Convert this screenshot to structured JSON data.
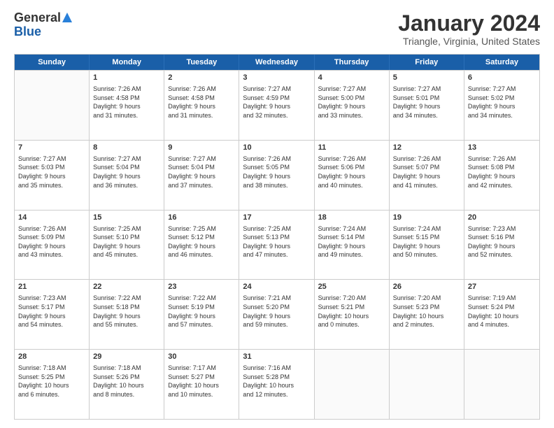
{
  "logo": {
    "general": "General",
    "blue": "Blue"
  },
  "title": {
    "month": "January 2024",
    "location": "Triangle, Virginia, United States"
  },
  "calendar": {
    "headers": [
      "Sunday",
      "Monday",
      "Tuesday",
      "Wednesday",
      "Thursday",
      "Friday",
      "Saturday"
    ],
    "rows": [
      [
        {
          "day": "",
          "lines": []
        },
        {
          "day": "1",
          "lines": [
            "Sunrise: 7:26 AM",
            "Sunset: 4:58 PM",
            "Daylight: 9 hours",
            "and 31 minutes."
          ]
        },
        {
          "day": "2",
          "lines": [
            "Sunrise: 7:26 AM",
            "Sunset: 4:58 PM",
            "Daylight: 9 hours",
            "and 31 minutes."
          ]
        },
        {
          "day": "3",
          "lines": [
            "Sunrise: 7:27 AM",
            "Sunset: 4:59 PM",
            "Daylight: 9 hours",
            "and 32 minutes."
          ]
        },
        {
          "day": "4",
          "lines": [
            "Sunrise: 7:27 AM",
            "Sunset: 5:00 PM",
            "Daylight: 9 hours",
            "and 33 minutes."
          ]
        },
        {
          "day": "5",
          "lines": [
            "Sunrise: 7:27 AM",
            "Sunset: 5:01 PM",
            "Daylight: 9 hours",
            "and 34 minutes."
          ]
        },
        {
          "day": "6",
          "lines": [
            "Sunrise: 7:27 AM",
            "Sunset: 5:02 PM",
            "Daylight: 9 hours",
            "and 34 minutes."
          ]
        }
      ],
      [
        {
          "day": "7",
          "lines": [
            "Sunrise: 7:27 AM",
            "Sunset: 5:03 PM",
            "Daylight: 9 hours",
            "and 35 minutes."
          ]
        },
        {
          "day": "8",
          "lines": [
            "Sunrise: 7:27 AM",
            "Sunset: 5:04 PM",
            "Daylight: 9 hours",
            "and 36 minutes."
          ]
        },
        {
          "day": "9",
          "lines": [
            "Sunrise: 7:27 AM",
            "Sunset: 5:04 PM",
            "Daylight: 9 hours",
            "and 37 minutes."
          ]
        },
        {
          "day": "10",
          "lines": [
            "Sunrise: 7:26 AM",
            "Sunset: 5:05 PM",
            "Daylight: 9 hours",
            "and 38 minutes."
          ]
        },
        {
          "day": "11",
          "lines": [
            "Sunrise: 7:26 AM",
            "Sunset: 5:06 PM",
            "Daylight: 9 hours",
            "and 40 minutes."
          ]
        },
        {
          "day": "12",
          "lines": [
            "Sunrise: 7:26 AM",
            "Sunset: 5:07 PM",
            "Daylight: 9 hours",
            "and 41 minutes."
          ]
        },
        {
          "day": "13",
          "lines": [
            "Sunrise: 7:26 AM",
            "Sunset: 5:08 PM",
            "Daylight: 9 hours",
            "and 42 minutes."
          ]
        }
      ],
      [
        {
          "day": "14",
          "lines": [
            "Sunrise: 7:26 AM",
            "Sunset: 5:09 PM",
            "Daylight: 9 hours",
            "and 43 minutes."
          ]
        },
        {
          "day": "15",
          "lines": [
            "Sunrise: 7:25 AM",
            "Sunset: 5:10 PM",
            "Daylight: 9 hours",
            "and 45 minutes."
          ]
        },
        {
          "day": "16",
          "lines": [
            "Sunrise: 7:25 AM",
            "Sunset: 5:12 PM",
            "Daylight: 9 hours",
            "and 46 minutes."
          ]
        },
        {
          "day": "17",
          "lines": [
            "Sunrise: 7:25 AM",
            "Sunset: 5:13 PM",
            "Daylight: 9 hours",
            "and 47 minutes."
          ]
        },
        {
          "day": "18",
          "lines": [
            "Sunrise: 7:24 AM",
            "Sunset: 5:14 PM",
            "Daylight: 9 hours",
            "and 49 minutes."
          ]
        },
        {
          "day": "19",
          "lines": [
            "Sunrise: 7:24 AM",
            "Sunset: 5:15 PM",
            "Daylight: 9 hours",
            "and 50 minutes."
          ]
        },
        {
          "day": "20",
          "lines": [
            "Sunrise: 7:23 AM",
            "Sunset: 5:16 PM",
            "Daylight: 9 hours",
            "and 52 minutes."
          ]
        }
      ],
      [
        {
          "day": "21",
          "lines": [
            "Sunrise: 7:23 AM",
            "Sunset: 5:17 PM",
            "Daylight: 9 hours",
            "and 54 minutes."
          ]
        },
        {
          "day": "22",
          "lines": [
            "Sunrise: 7:22 AM",
            "Sunset: 5:18 PM",
            "Daylight: 9 hours",
            "and 55 minutes."
          ]
        },
        {
          "day": "23",
          "lines": [
            "Sunrise: 7:22 AM",
            "Sunset: 5:19 PM",
            "Daylight: 9 hours",
            "and 57 minutes."
          ]
        },
        {
          "day": "24",
          "lines": [
            "Sunrise: 7:21 AM",
            "Sunset: 5:20 PM",
            "Daylight: 9 hours",
            "and 59 minutes."
          ]
        },
        {
          "day": "25",
          "lines": [
            "Sunrise: 7:20 AM",
            "Sunset: 5:21 PM",
            "Daylight: 10 hours",
            "and 0 minutes."
          ]
        },
        {
          "day": "26",
          "lines": [
            "Sunrise: 7:20 AM",
            "Sunset: 5:23 PM",
            "Daylight: 10 hours",
            "and 2 minutes."
          ]
        },
        {
          "day": "27",
          "lines": [
            "Sunrise: 7:19 AM",
            "Sunset: 5:24 PM",
            "Daylight: 10 hours",
            "and 4 minutes."
          ]
        }
      ],
      [
        {
          "day": "28",
          "lines": [
            "Sunrise: 7:18 AM",
            "Sunset: 5:25 PM",
            "Daylight: 10 hours",
            "and 6 minutes."
          ]
        },
        {
          "day": "29",
          "lines": [
            "Sunrise: 7:18 AM",
            "Sunset: 5:26 PM",
            "Daylight: 10 hours",
            "and 8 minutes."
          ]
        },
        {
          "day": "30",
          "lines": [
            "Sunrise: 7:17 AM",
            "Sunset: 5:27 PM",
            "Daylight: 10 hours",
            "and 10 minutes."
          ]
        },
        {
          "day": "31",
          "lines": [
            "Sunrise: 7:16 AM",
            "Sunset: 5:28 PM",
            "Daylight: 10 hours",
            "and 12 minutes."
          ]
        },
        {
          "day": "",
          "lines": []
        },
        {
          "day": "",
          "lines": []
        },
        {
          "day": "",
          "lines": []
        }
      ]
    ]
  }
}
